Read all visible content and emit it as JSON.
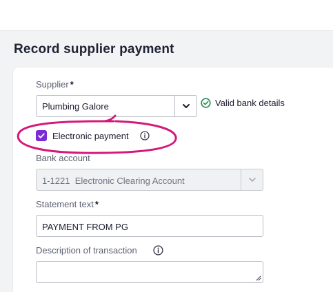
{
  "page": {
    "title": "Record supplier payment"
  },
  "form": {
    "supplier": {
      "label": "Supplier",
      "required_mark": "*",
      "value": "Plumbing Galore",
      "status_text": "Valid bank details"
    },
    "electronic_payment": {
      "label": "Electronic payment",
      "checked": true
    },
    "bank_account": {
      "label": "Bank account",
      "value": "1-1221  Electronic Clearing Account"
    },
    "statement_text": {
      "label": "Statement text",
      "required_mark": "*",
      "value": "PAYMENT FROM PG"
    },
    "description": {
      "label": "Description of transaction",
      "value": ""
    }
  },
  "colors": {
    "checkbox": "#7b2cd4",
    "valid_icon": "#1e8a4c",
    "annotation_ring": "#d4197a"
  },
  "icons": {
    "chevron": "chevron-down-icon",
    "valid": "check-circle-icon",
    "info": "info-icon"
  }
}
